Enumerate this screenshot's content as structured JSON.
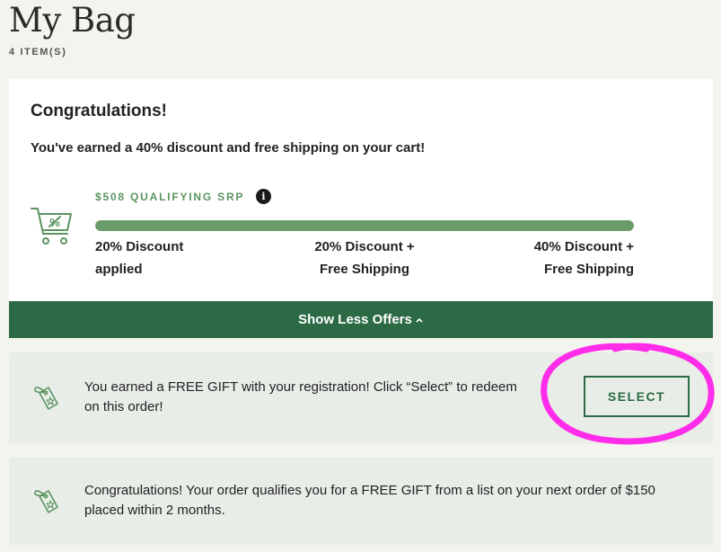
{
  "page": {
    "title": "My Bag",
    "item_count": "4 ITEM(S)"
  },
  "offers": {
    "heading": "Congratulations!",
    "subheading": "You've earned a 40% discount and free shipping on your cart!",
    "qualifying_label": "$508 QUALIFYING SRP",
    "info_icon": "info-icon",
    "progress_percent": 100,
    "tiers": [
      {
        "line1": "20% Discount",
        "line2": "applied"
      },
      {
        "line1": "20% Discount +",
        "line2": "Free Shipping"
      },
      {
        "line1": "40% Discount +",
        "line2": "Free Shipping"
      }
    ],
    "toggle_label": "Show Less Offers",
    "colors": {
      "accent": "#2b6a44",
      "progress": "#6a9b6a",
      "label": "#5b9460"
    }
  },
  "gifts": [
    {
      "icon": "gift-tag-icon",
      "text": "You earned a FREE GIFT with your registration! Click “Select” to redeem on this order!",
      "button_label": "SELECT"
    },
    {
      "icon": "gift-tag-icon",
      "text": "Congratulations! Your order qualifies you for a FREE GIFT from a list on your next order of $150 placed within 2 months."
    }
  ],
  "annotation": {
    "color": "#ff2dea"
  }
}
